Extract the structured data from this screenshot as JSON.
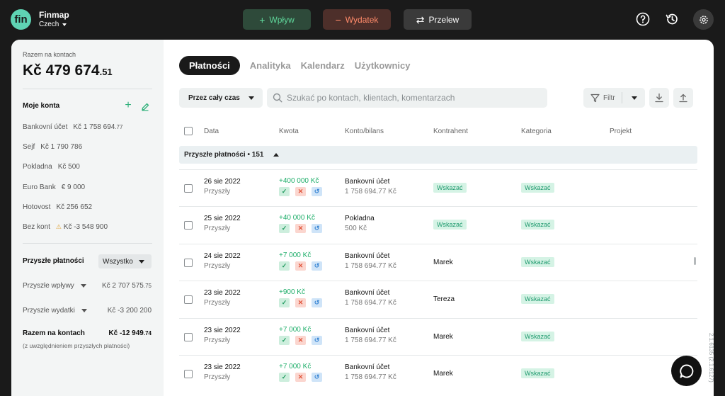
{
  "app": {
    "brand": "Finmap",
    "company": "Czech",
    "logo_text": "fin"
  },
  "topbar": {
    "income_label": "Wpływ",
    "expense_label": "Wydatek",
    "transfer_label": "Przelew",
    "icons": [
      "help-icon",
      "history-icon",
      "gear-icon"
    ]
  },
  "sidebar": {
    "total_label": "Razem na kontach",
    "total_main": "Kč 479 674",
    "total_cents": ".51",
    "accounts_title": "Moje konta",
    "accounts": [
      {
        "name": "Bankovní účet",
        "amount": "Kč 1 758 694",
        "cents": ".77",
        "warn": false
      },
      {
        "name": "Sejf",
        "amount": "Kč 1 790 786",
        "cents": "",
        "warn": false
      },
      {
        "name": "Pokladna",
        "amount": "Kč 500",
        "cents": "",
        "warn": false
      },
      {
        "name": "Euro Bank",
        "amount": "€ 9 000",
        "cents": "",
        "warn": false
      },
      {
        "name": "Hotovost",
        "amount": "Kč 256 652",
        "cents": "",
        "warn": false
      },
      {
        "name": "Bez kont",
        "amount": "Kč -3 548 900",
        "cents": "",
        "warn": true
      }
    ],
    "future_title": "Przyszłe płatności",
    "future_select": "Wszystko",
    "future_income_label": "Przyszłe wpływy",
    "future_income_value": "Kč 2 707 575",
    "future_income_cents": ".75",
    "future_expense_label": "Przyszłe wydatki",
    "future_expense_value": "Kč -3 200 200",
    "sum_label": "Razem na kontach",
    "sum_value": "Kč -12 949",
    "sum_cents": ".74",
    "sum_note": "(z uwzględnieniem przyszłych płatności)"
  },
  "main": {
    "tabs": [
      {
        "label": "Płatności",
        "active": true
      },
      {
        "label": "Analityka",
        "active": false
      },
      {
        "label": "Kalendarz",
        "active": false
      },
      {
        "label": "Użytkownicy",
        "active": false
      }
    ],
    "period": "Przez cały czas",
    "search_placeholder": "Szukać po kontach, klientach, komentarzach",
    "filter_label": "Filtr",
    "columns": [
      "Data",
      "Kwota",
      "Konto/bilans",
      "Kontrahent",
      "Kategoria",
      "Projekt"
    ],
    "group_label": "Przyszłe płatności • 151",
    "rows": [
      {
        "date": "26 sie 2022",
        "status": "Przyszły",
        "amount": "+400 000 Kč",
        "account": "Bankovní účet",
        "balance": "1 758 694.77 Kč",
        "contractor": "",
        "contractor_pill": "Wskazać",
        "category": "Wskazać"
      },
      {
        "date": "25 sie 2022",
        "status": "Przyszły",
        "amount": "+40 000 Kč",
        "account": "Pokladna",
        "balance": "500 Kč",
        "contractor": "",
        "contractor_pill": "Wskazać",
        "category": "Wskazać"
      },
      {
        "date": "24 sie 2022",
        "status": "Przyszły",
        "amount": "+7 000 Kč",
        "account": "Bankovní účet",
        "balance": "1 758 694.77 Kč",
        "contractor": "Marek",
        "contractor_pill": "",
        "category": "Wskazać"
      },
      {
        "date": "23 sie 2022",
        "status": "Przyszły",
        "amount": "+900 Kč",
        "account": "Bankovní účet",
        "balance": "1 758 694.77 Kč",
        "contractor": "Tereza",
        "contractor_pill": "",
        "category": "Wskazać"
      },
      {
        "date": "23 sie 2022",
        "status": "Przyszły",
        "amount": "+7 000 Kč",
        "account": "Bankovní účet",
        "balance": "1 758 694.77 Kč",
        "contractor": "Marek",
        "contractor_pill": "",
        "category": "Wskazać"
      },
      {
        "date": "23 sie 2022",
        "status": "Przyszły",
        "amount": "+7 000 Kč",
        "account": "Bankovní účet",
        "balance": "1 758 694.77 Kč",
        "contractor": "Marek",
        "contractor_pill": "",
        "category": "Wskazać"
      }
    ]
  },
  "version": "2.1.6135 (2.1.6127)",
  "colors": {
    "accent_green": "#5fd4b4",
    "income": "#1fae6a",
    "expense": "#ff8a6a"
  }
}
